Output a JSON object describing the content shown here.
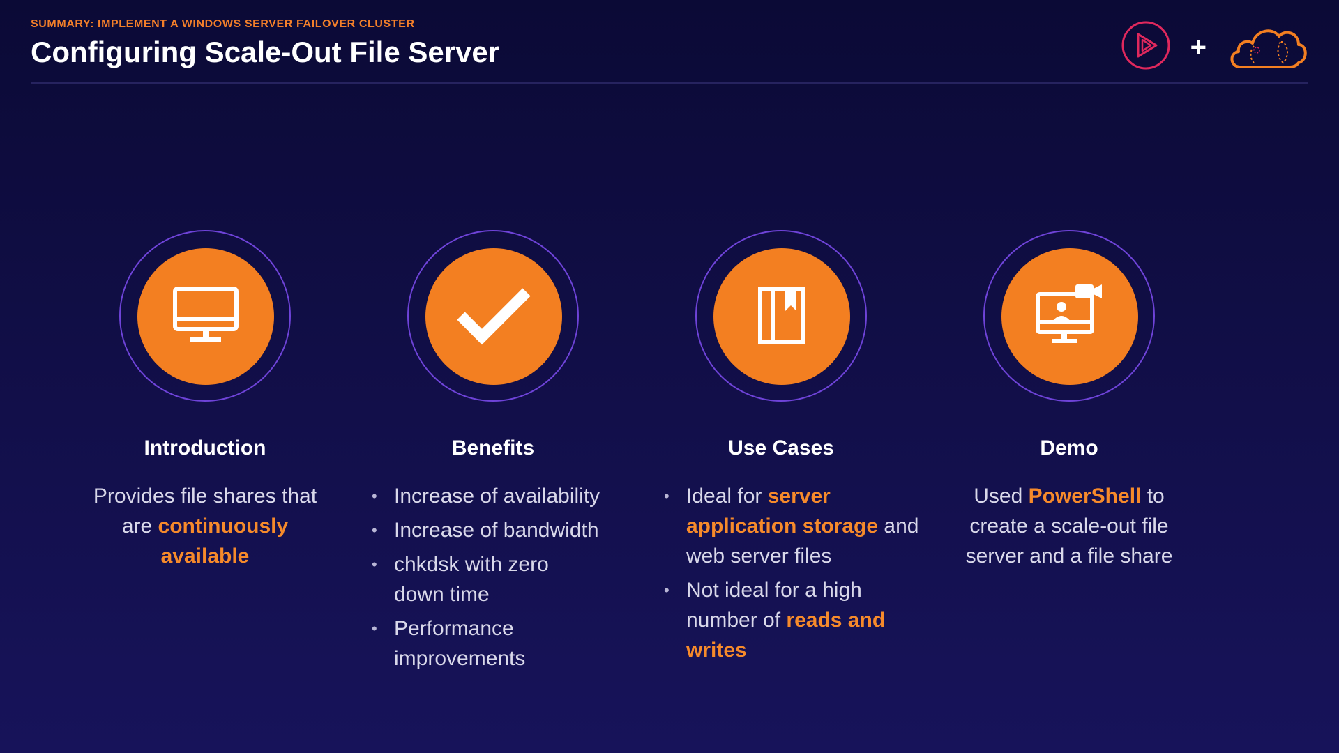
{
  "header": {
    "kicker": "SUMMARY: IMPLEMENT A WINDOWS SERVER FAILOVER CLUSTER",
    "title": "Configuring Scale-Out File Server",
    "plus": "+"
  },
  "brand": {
    "icons": [
      "pluralsight-play-logo-icon",
      "cloud-logo-icon"
    ],
    "colors": {
      "play_logo": "#e0285d",
      "cloud_logo": "#f37f21"
    }
  },
  "colors": {
    "background_top": "#0b0a36",
    "background_bottom": "#17135a",
    "accent_orange": "#f37f21",
    "ring_purple": "#6e43d8",
    "body_text": "#d9d8ea"
  },
  "columns": {
    "intro": {
      "icon": "monitor-icon",
      "title": "Introduction",
      "text_a": "Provides file shares that are ",
      "text_hl": "continuously available"
    },
    "benefits": {
      "icon": "checkmark-icon",
      "title": "Benefits",
      "items": [
        "Increase of availability",
        "Increase of bandwidth",
        "chkdsk with zero down time",
        "Performance improvements"
      ]
    },
    "usecases": {
      "icon": "book-icon",
      "title": "Use Cases",
      "item1_a": "Ideal for ",
      "item1_hl": "server application storage",
      "item1_b": " and web server files",
      "item2_a": "Not ideal for a high number of ",
      "item2_hl": "reads and writes"
    },
    "demo": {
      "icon": "video-presentation-icon",
      "title": "Demo",
      "text_a": "Used ",
      "text_hl": "PowerShell",
      "text_b": " to create a scale-out file server and a file share"
    }
  }
}
